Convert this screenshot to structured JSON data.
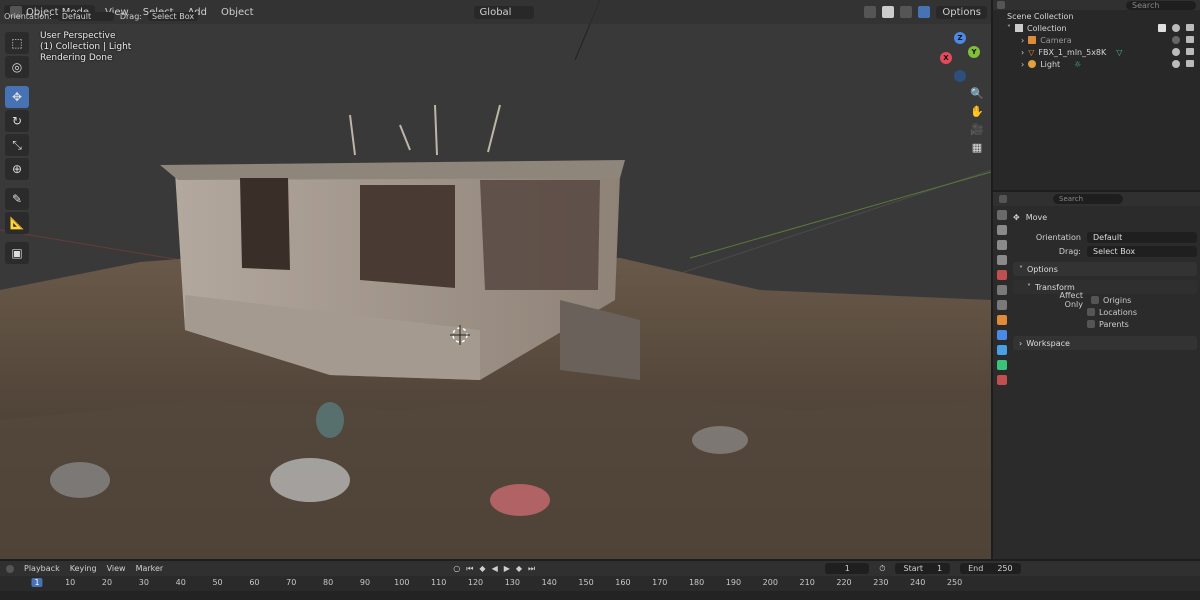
{
  "viewport_header": {
    "mode": "Object Mode",
    "menus": [
      "View",
      "Select",
      "Add",
      "Object"
    ],
    "transform_orientation": "Global",
    "options": "Options"
  },
  "tool_settings": {
    "orientation_label": "Orientation:",
    "orientation_value": "Default",
    "drag_label": "Drag:",
    "drag_value": "Select Box"
  },
  "viewport_info": {
    "perspective": "User Perspective",
    "collection": "(1) Collection | Light",
    "status": "Rendering Done"
  },
  "gizmo": {
    "z": "Z",
    "y": "Y",
    "x": "X"
  },
  "outliner": {
    "search_placeholder": "Search",
    "scene_collection": "Scene Collection",
    "collection": "Collection",
    "items": [
      {
        "label": "Camera",
        "icon": "camera-icon"
      },
      {
        "label": "FBX_1_mln_5x8K",
        "icon": "mesh-icon"
      },
      {
        "label": "Light",
        "icon": "light-icon"
      }
    ]
  },
  "properties": {
    "search_placeholder": "Search",
    "tool_name": "Move",
    "orientation_label": "Orientation",
    "orientation_value": "Default",
    "drag_label": "Drag:",
    "drag_value": "Select Box",
    "options_panel": "Options",
    "transform_panel": "Transform",
    "affect_only_label": "Affect Only",
    "affect_only_options": [
      "Origins",
      "Locations",
      "Parents"
    ],
    "workspace_panel": "Workspace"
  },
  "timeline": {
    "menus": [
      "Playback",
      "Keying",
      "View",
      "Marker"
    ],
    "current_frame": "1",
    "start_label": "Start",
    "start_value": "1",
    "end_label": "End",
    "end_value": "250",
    "ruler_current": "1",
    "ruler": [
      "10",
      "20",
      "30",
      "40",
      "50",
      "60",
      "70",
      "80",
      "90",
      "100",
      "110",
      "120",
      "130",
      "140",
      "150",
      "160",
      "170",
      "180",
      "190",
      "200",
      "210",
      "220",
      "230",
      "240",
      "250"
    ]
  },
  "colors": {
    "accent": "#4772b3",
    "axis_x": "#e54a5a",
    "axis_y": "#7fbf3a",
    "axis_z": "#4a8ae5"
  }
}
